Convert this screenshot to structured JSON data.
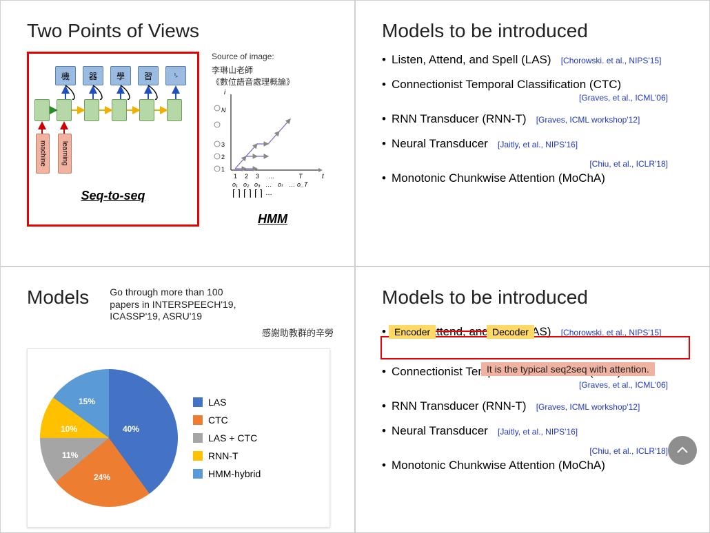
{
  "colors": {
    "red": "#e60000",
    "cite": "#2038c8",
    "highlight": "#ffd966",
    "note_bg": "#f1b3a1"
  },
  "slide1": {
    "title": "Two Points of Views",
    "seq2seq_caption": "Seq-to-seq",
    "hmm_caption": "HMM",
    "source_label": "Source of image:",
    "source_line1": "李琳山老師",
    "source_line2": "《數位語音處理概論》",
    "blue_labels": [
      "機",
      "器",
      "學",
      "習",
      "␠"
    ],
    "pink_labels": [
      "machine",
      "learning"
    ]
  },
  "slide2": {
    "title": "Models to be introduced",
    "items": [
      {
        "text": "Listen, Attend, and Spell (LAS)",
        "cite": "[Chorowski. et al., NIPS'15]",
        "cite_inline": true
      },
      {
        "text": "Connectionist Temporal Classification (CTC)",
        "cite": "[Graves, et al., ICML'06]",
        "cite_inline": false
      },
      {
        "text": "RNN Transducer (RNN-T)",
        "cite": "[Graves, ICML workshop'12]",
        "cite_inline": true
      },
      {
        "text": "Neural Transducer",
        "cite": "[Jaitly, et al., NIPS'16]",
        "cite_inline": true
      },
      {
        "text": "Monotonic Chunkwise Attention (MoChA)",
        "cite": "[Chiu, et al., ICLR'18]",
        "cite_inline": false,
        "cite_above": true
      }
    ]
  },
  "slide3": {
    "title": "Models",
    "note": "Go through more than 100 papers in INTERSPEECH'19, ICASSP'19, ASRU'19",
    "thanks": "感謝助教群的辛勞"
  },
  "slide4": {
    "title": "Models to be introduced",
    "encoder": "Encoder",
    "decoder": "Decoder",
    "typical_note": "It is the typical seq2seq with attention.",
    "items": [
      {
        "text": "Listen, Attend, and Spell (LAS)",
        "cite": "[Chorowski. et al., NIPS'15]",
        "cite_inline": true
      },
      {
        "text": "Connectionist Temporal Classification (CTC)",
        "cite": "[Graves, et al., ICML'06]",
        "cite_inline": false
      },
      {
        "text": "RNN Transducer (RNN-T)",
        "cite": "[Graves, ICML workshop'12]",
        "cite_inline": true
      },
      {
        "text": "Neural Transducer",
        "cite": "[Jaitly, et al., NIPS'16]",
        "cite_inline": true
      },
      {
        "text": "Monotonic Chunkwise Attention (MoChA)",
        "cite": "[Chiu, et al., ICLR'18]",
        "cite_inline": false,
        "cite_above": true
      }
    ]
  },
  "chart_data": {
    "type": "pie",
    "title": "",
    "series": [
      {
        "name": "LAS",
        "value": 40,
        "color": "#4472c4"
      },
      {
        "name": "CTC",
        "value": 24,
        "color": "#ed7d31"
      },
      {
        "name": "LAS + CTC",
        "value": 11,
        "color": "#a5a5a5"
      },
      {
        "name": "RNN-T",
        "value": 10,
        "color": "#ffc000"
      },
      {
        "name": "HMM-hybrid",
        "value": 15,
        "color": "#5b9bd5"
      }
    ],
    "labels_on_slices": [
      "40%",
      "24%",
      "11%",
      "10%",
      "15%"
    ]
  }
}
